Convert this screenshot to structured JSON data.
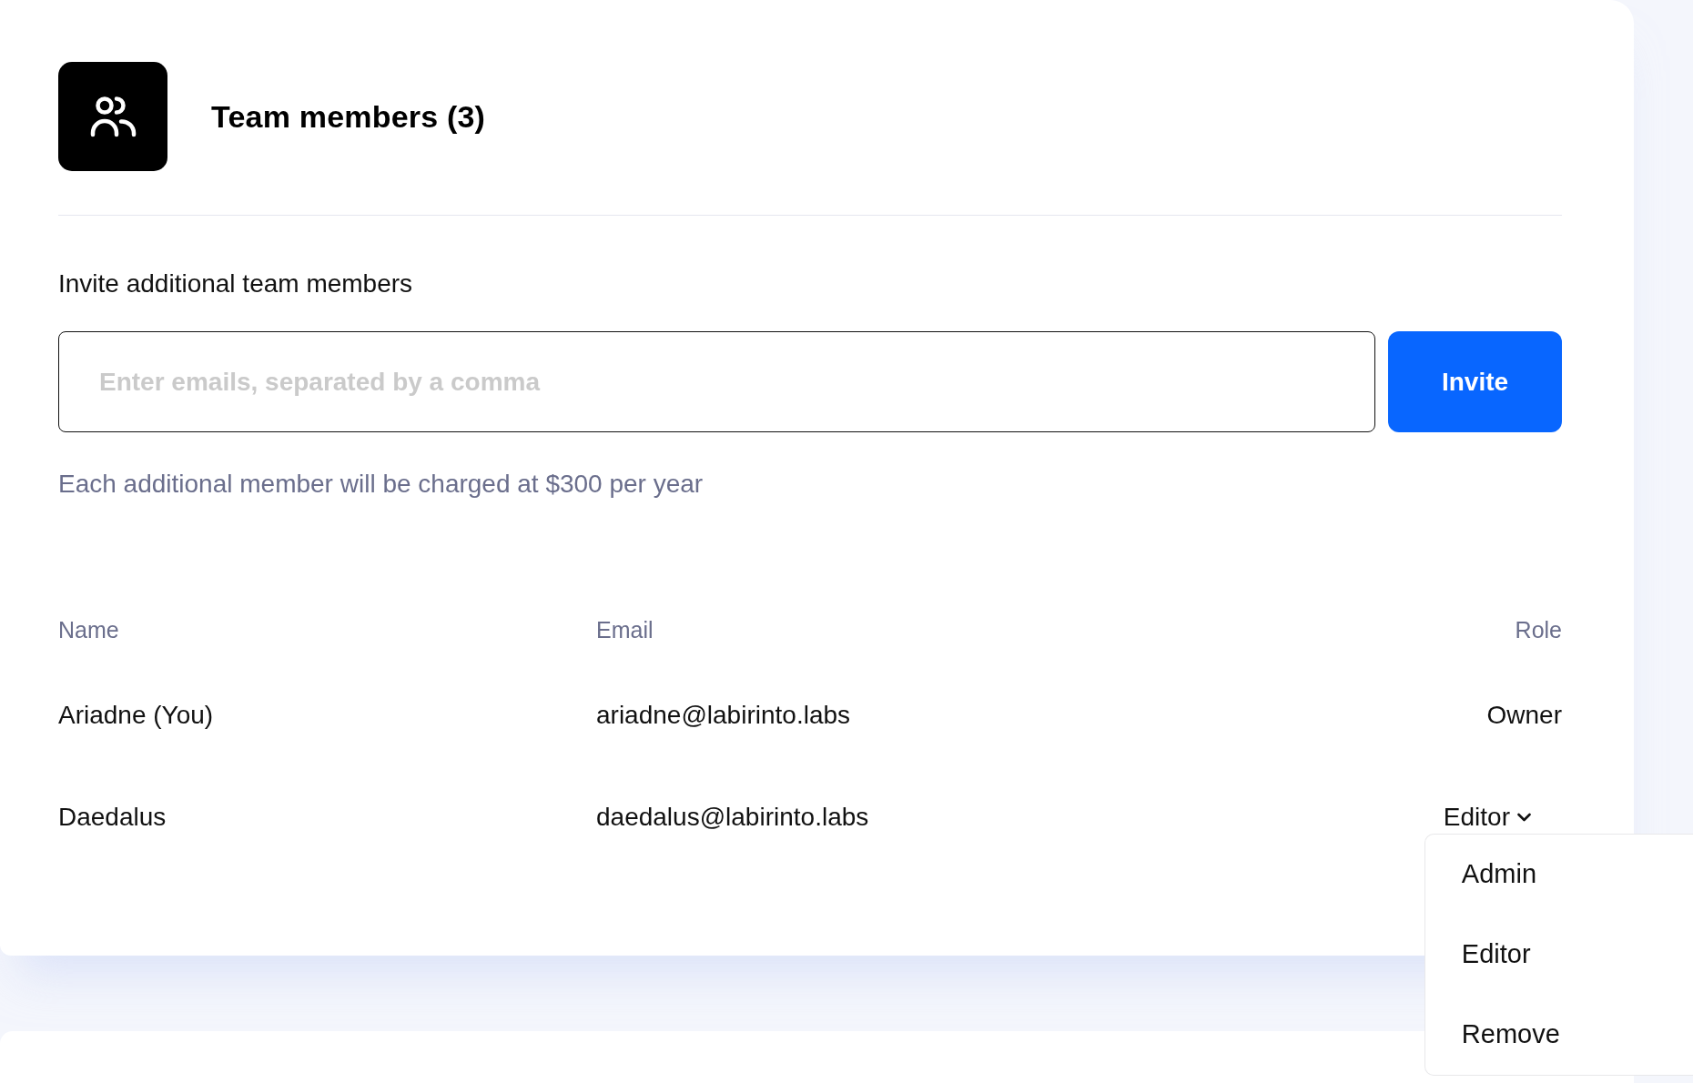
{
  "header": {
    "title": "Team members (3)"
  },
  "invite": {
    "label": "Invite additional team members",
    "placeholder": "Enter emails, separated by a comma",
    "button": "Invite",
    "note": "Each additional member will be charged at $300 per year"
  },
  "table": {
    "columns": [
      "Name",
      "Email",
      "Role"
    ],
    "rows": [
      {
        "name": "Ariadne (You)",
        "email": "ariadne@labirinto.labs",
        "role": {
          "kind": "text",
          "label": "Owner"
        }
      },
      {
        "name": "Daedalus",
        "email": "daedalus@labirinto.labs",
        "role": {
          "kind": "dropdown",
          "label": "Editor",
          "expanded": true,
          "options": [
            "Admin",
            "Editor",
            "Remove"
          ]
        }
      }
    ]
  }
}
